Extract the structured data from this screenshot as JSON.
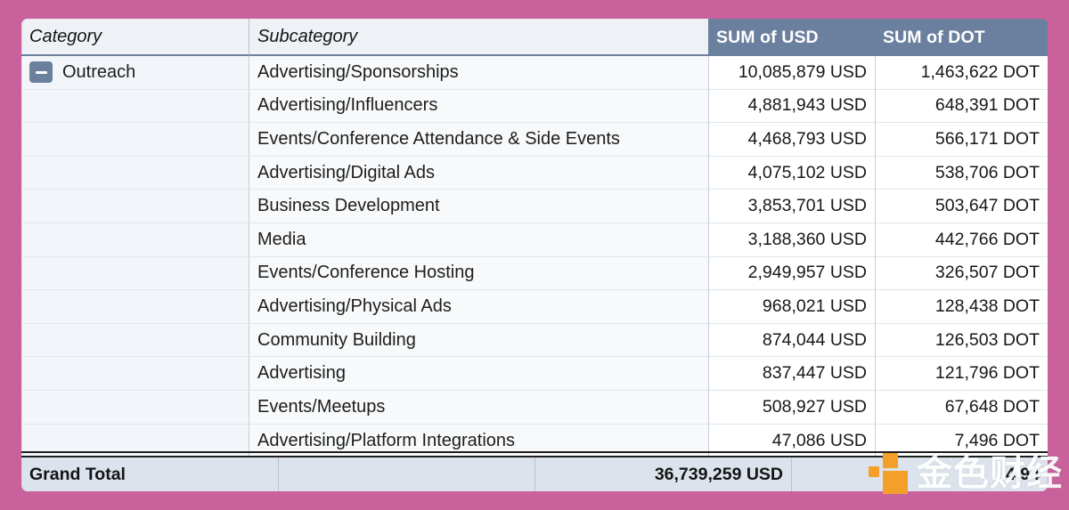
{
  "table": {
    "headers": {
      "category": "Category",
      "subcategory": "Subcategory",
      "sum_usd": "SUM of USD",
      "sum_dot": "SUM of DOT"
    },
    "group": {
      "name": "Outreach",
      "collapse_icon": "minus-icon",
      "expanded": true
    },
    "rows": [
      {
        "subcategory": "Advertising/Sponsorships",
        "usd": "10,085,879 USD",
        "dot": "1,463,622 DOT"
      },
      {
        "subcategory": "Advertising/Influencers",
        "usd": "4,881,943 USD",
        "dot": "648,391 DOT"
      },
      {
        "subcategory": "Events/Conference Attendance & Side Events",
        "usd": "4,468,793 USD",
        "dot": "566,171 DOT"
      },
      {
        "subcategory": "Advertising/Digital Ads",
        "usd": "4,075,102 USD",
        "dot": "538,706 DOT"
      },
      {
        "subcategory": "Business Development",
        "usd": "3,853,701 USD",
        "dot": "503,647 DOT"
      },
      {
        "subcategory": "Media",
        "usd": "3,188,360 USD",
        "dot": "442,766 DOT"
      },
      {
        "subcategory": "Events/Conference Hosting",
        "usd": "2,949,957 USD",
        "dot": "326,507 DOT"
      },
      {
        "subcategory": "Advertising/Physical Ads",
        "usd": "968,021 USD",
        "dot": "128,438 DOT"
      },
      {
        "subcategory": "Community Building",
        "usd": "874,044 USD",
        "dot": "126,503 DOT"
      },
      {
        "subcategory": "Advertising",
        "usd": "837,447 USD",
        "dot": "121,796 DOT"
      },
      {
        "subcategory": "Events/Meetups",
        "usd": "508,927 USD",
        "dot": "67,648 DOT"
      },
      {
        "subcategory": "Advertising/Platform Integrations",
        "usd": "47,086 USD",
        "dot": "7,496 DOT"
      }
    ],
    "grand_total": {
      "label": "Grand Total",
      "subcategory": "",
      "usd": "36,739,259 USD",
      "dot": "4,94"
    }
  },
  "watermark": {
    "text": "金色财经",
    "logo_icon": "jinse-blocks-logo-icon",
    "logo_color": "#f2a02a"
  },
  "theme": {
    "page_background": "#c9629c",
    "header_measure_background": "#6b7f9e",
    "header_label_background": "#eef1f5",
    "row_value_background": "#ffffff",
    "grand_total_background": "#dde3ec"
  }
}
